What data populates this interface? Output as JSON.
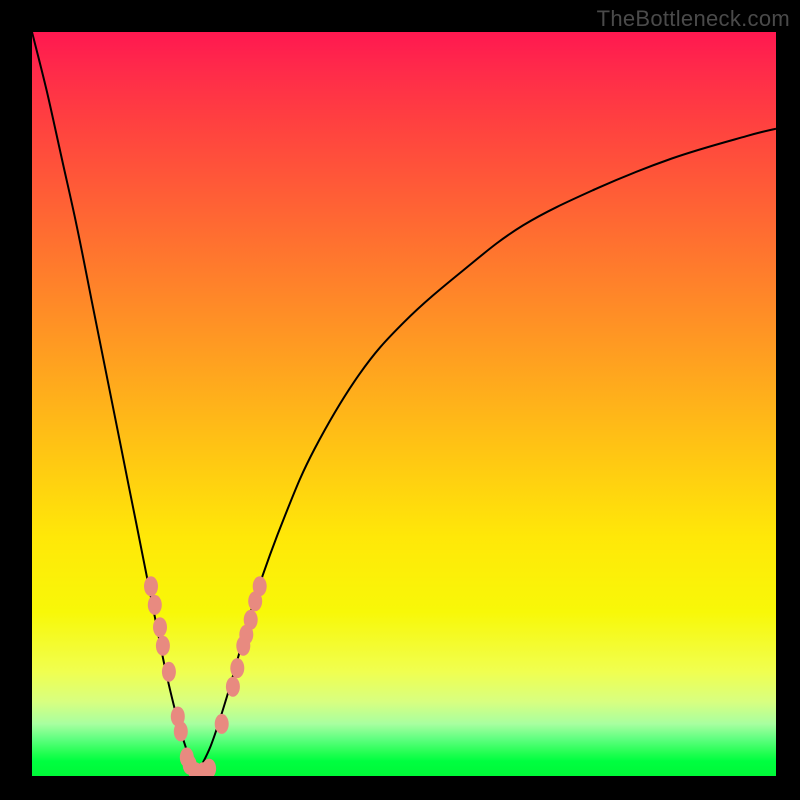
{
  "watermark": "TheBottleneck.com",
  "colors": {
    "bead": "#e88a80",
    "curve": "#000000",
    "frame": "#000000"
  },
  "chart_data": {
    "type": "line",
    "title": "",
    "xlabel": "",
    "ylabel": "",
    "xlim": [
      0,
      100
    ],
    "ylim": [
      0,
      100
    ],
    "grid": false,
    "legend": false,
    "note": "V-shaped bottleneck curve. y is mismatch percentage (top=100, bottom=0). Background gradient red→green indicates worse→better. Two branches meet near x≈22.",
    "series": [
      {
        "name": "left-branch",
        "x": [
          0,
          2,
          4,
          6,
          8,
          10,
          12,
          14,
          16,
          18,
          20,
          22
        ],
        "y": [
          100,
          92,
          83,
          74,
          64,
          54,
          44,
          34,
          24,
          14,
          6,
          0
        ]
      },
      {
        "name": "right-branch",
        "x": [
          22,
          24,
          26,
          28,
          30,
          34,
          38,
          44,
          50,
          58,
          66,
          76,
          86,
          96,
          100
        ],
        "y": [
          0,
          4,
          10,
          17,
          24,
          35,
          44,
          54,
          61,
          68,
          74,
          79,
          83,
          86,
          87
        ]
      }
    ],
    "markers": {
      "name": "sample-beads",
      "note": "salmon-colored sample markers along the curve near the trough",
      "points": [
        {
          "x": 16.0,
          "y": 25.5
        },
        {
          "x": 16.5,
          "y": 23.0
        },
        {
          "x": 17.2,
          "y": 20.0
        },
        {
          "x": 17.6,
          "y": 17.5
        },
        {
          "x": 18.4,
          "y": 14.0
        },
        {
          "x": 19.6,
          "y": 8.0
        },
        {
          "x": 20.0,
          "y": 6.0
        },
        {
          "x": 20.8,
          "y": 2.5
        },
        {
          "x": 21.2,
          "y": 1.5
        },
        {
          "x": 22.0,
          "y": 0.5
        },
        {
          "x": 23.0,
          "y": 0.5
        },
        {
          "x": 23.8,
          "y": 1.0
        },
        {
          "x": 25.5,
          "y": 7.0
        },
        {
          "x": 27.0,
          "y": 12.0
        },
        {
          "x": 27.6,
          "y": 14.5
        },
        {
          "x": 28.4,
          "y": 17.5
        },
        {
          "x": 28.8,
          "y": 19.0
        },
        {
          "x": 29.4,
          "y": 21.0
        },
        {
          "x": 30.0,
          "y": 23.5
        },
        {
          "x": 30.6,
          "y": 25.5
        }
      ]
    }
  }
}
